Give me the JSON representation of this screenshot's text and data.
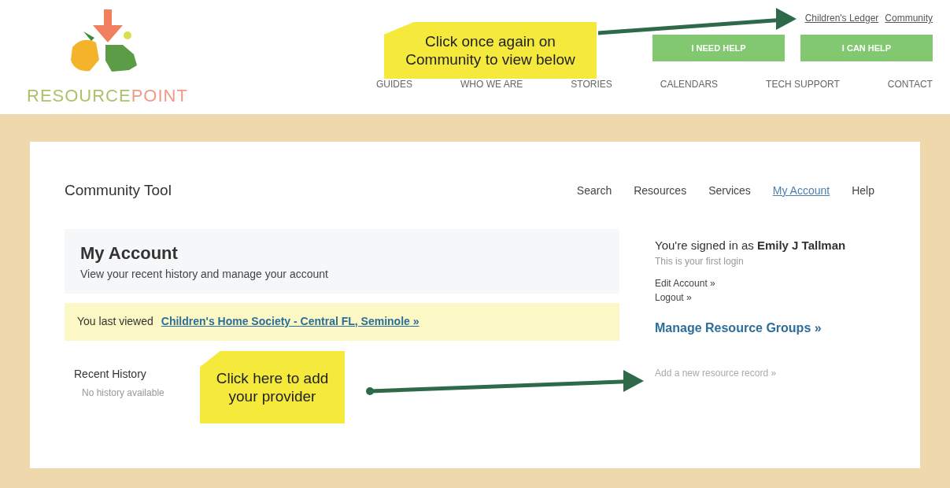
{
  "logo": {
    "word_1": "RESOURCE",
    "word_2": "POINT"
  },
  "top_links": [
    {
      "label": "Children's Ledger"
    },
    {
      "label": "Community"
    }
  ],
  "help_buttons": [
    "I NEED HELP",
    "I CAN HELP"
  ],
  "main_nav": [
    "GUIDES",
    "WHO WE ARE",
    "STORIES",
    "CALENDARS",
    "TECH SUPPORT",
    "CONTACT"
  ],
  "tool": {
    "title": "Community Tool",
    "tabs": [
      {
        "label": "Search",
        "selected": false
      },
      {
        "label": "Resources",
        "selected": false
      },
      {
        "label": "Services",
        "selected": false
      },
      {
        "label": "My Account",
        "selected": true
      },
      {
        "label": "Help",
        "selected": false
      }
    ]
  },
  "account": {
    "title": "My Account",
    "subtitle": "View your recent history and manage your account",
    "last_viewed_label": "You last viewed",
    "last_viewed_link": "Children's Home Society - Central FL, Seminole »",
    "history_title": "Recent History",
    "history_empty": "No history available"
  },
  "sidebar": {
    "signed_in": "You're signed in as **Emily J Tallman**",
    "note": "This is your first login",
    "links": [
      "Edit Account »",
      "Logout »"
    ],
    "groups_link": "Manage Resource Groups »",
    "add_link": "Add a new resource record »"
  },
  "callouts": [
    {
      "text": "Click once again on Community to view below"
    },
    {
      "text": "Click here to add your provider"
    }
  ]
}
